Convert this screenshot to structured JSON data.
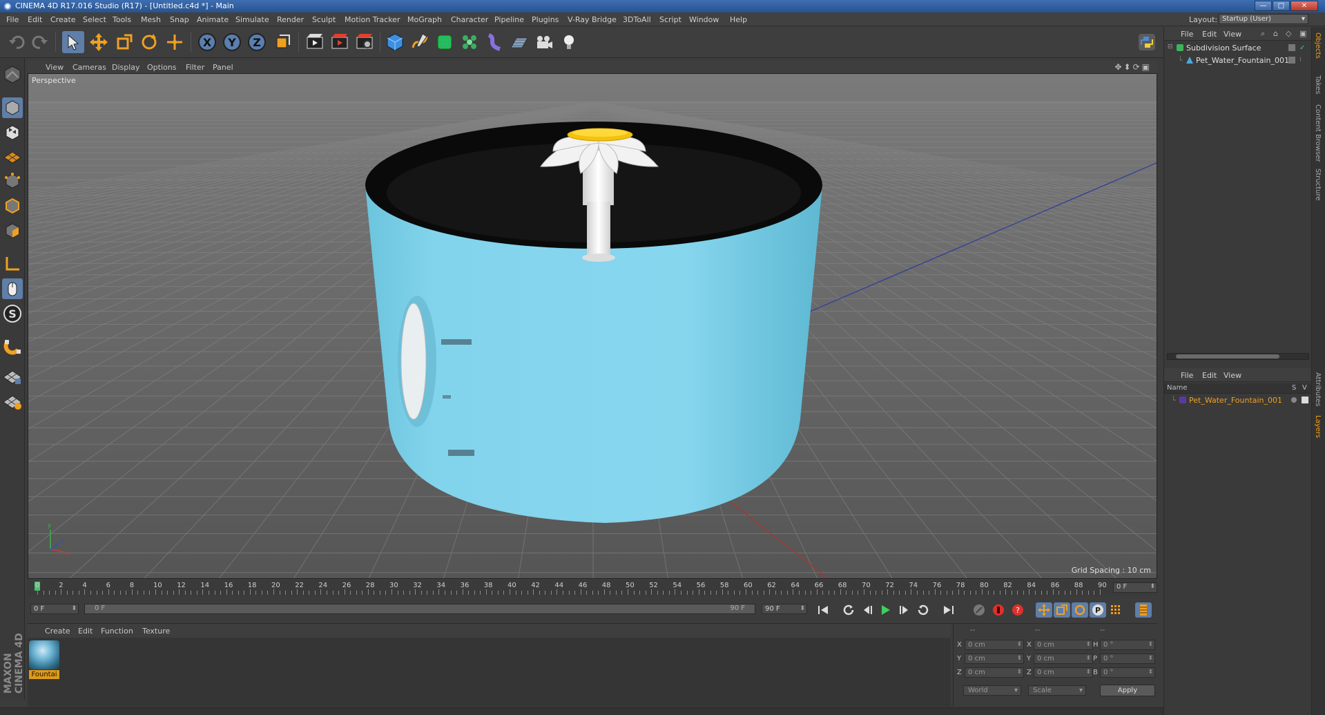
{
  "window": {
    "title": "CINEMA 4D R17.016 Studio (R17) - [Untitled.c4d *] - Main",
    "minimize": "—",
    "maximize": "□",
    "close": "✕"
  },
  "menubar": {
    "items": [
      "File",
      "Edit",
      "Create",
      "Select",
      "Tools",
      "Mesh",
      "Snap",
      "Animate",
      "Simulate",
      "Render",
      "Sculpt",
      "Motion Tracker",
      "MoGraph",
      "Character",
      "Pipeline",
      "Plugins",
      "V-Ray Bridge",
      "3DToAll",
      "Script",
      "Window",
      "Help"
    ],
    "layout_label": "Layout:",
    "layout_value": "Startup (User)"
  },
  "toolbar": {
    "icons": [
      "undo-icon",
      "redo-icon",
      "live-selection-icon",
      "move-icon",
      "scale-icon",
      "rotate-icon",
      "recent-tool-icon",
      "x-axis-icon",
      "y-axis-icon",
      "z-axis-icon",
      "coordinate-system-icon",
      "render-view-icon",
      "render-picture-viewer-icon",
      "edit-render-settings-icon",
      "cube-icon",
      "pen-spline-icon",
      "subdivision-surface-icon",
      "cloner-icon",
      "deformer-icon",
      "floor-icon",
      "camera-icon",
      "light-icon",
      "python-icon"
    ],
    "axis_x": "X",
    "axis_y": "Y",
    "axis_z": "Z"
  },
  "left_toolbar": {
    "icons": [
      "make-editable-icon",
      "model-mode-icon",
      "texture-mode-icon",
      "workplane-icon",
      "points-mode-icon",
      "edges-mode-icon",
      "polygons-mode-icon",
      "axis-mode-icon",
      "tweak-mode-icon",
      "solo-icon",
      "snap-icon",
      "grid-lock-icon",
      "quantize-icon"
    ],
    "solo_letter": "S",
    "brand": "MAXON CINEMA 4D"
  },
  "viewport": {
    "menu": [
      "View",
      "Cameras",
      "Display",
      "Options",
      "Filter",
      "Panel"
    ],
    "label": "Perspective",
    "grid_spacing": "Grid Spacing : 10 cm",
    "axis_x": "x",
    "axis_y": "y",
    "axis_z": "z",
    "colors": {
      "background": "#6b6b6b",
      "grid": "#7d7d7d",
      "fountain_body": "#7fd2ea",
      "fountain_top": "#0a0a0a",
      "petal": "#f0f0f0",
      "cap": "#f4c20d"
    }
  },
  "timeline": {
    "ticks": [
      "0",
      "2",
      "4",
      "6",
      "8",
      "10",
      "12",
      "14",
      "16",
      "18",
      "20",
      "22",
      "24",
      "26",
      "28",
      "30",
      "32",
      "34",
      "36",
      "38",
      "40",
      "42",
      "44",
      "46",
      "48",
      "50",
      "52",
      "54",
      "56",
      "58",
      "60",
      "62",
      "64",
      "66",
      "68",
      "70",
      "72",
      "74",
      "76",
      "78",
      "80",
      "82",
      "84",
      "86",
      "88",
      "90"
    ],
    "current_frame": "0 F"
  },
  "transport": {
    "start_field": "0 F",
    "slider_left": "0 F",
    "slider_right": "90 F",
    "end_field": "90 F",
    "buttons": [
      "go-to-start-icon",
      "previous-keyframe-icon",
      "previous-frame-icon",
      "play-icon",
      "next-frame-icon",
      "next-keyframe-icon",
      "go-to-end-icon",
      "autokey-icon",
      "record-icon",
      "keyframe-selection-icon",
      "move-key-icon",
      "scale-key-icon",
      "rotate-key-icon",
      "parameter-key-icon",
      "pla-key-icon",
      "timeline-icon"
    ]
  },
  "material_manager": {
    "menu": [
      "Create",
      "Edit",
      "Function",
      "Texture"
    ],
    "materials": [
      {
        "name": "Fountai"
      }
    ]
  },
  "coordinates": {
    "headers": [
      "--",
      "--",
      "--"
    ],
    "rows": [
      {
        "a": "X",
        "av": "0 cm",
        "b": "X",
        "bv": "0 cm",
        "c": "H",
        "cv": "0 °"
      },
      {
        "a": "Y",
        "av": "0 cm",
        "b": "Y",
        "bv": "0 cm",
        "c": "P",
        "cv": "0 °"
      },
      {
        "a": "Z",
        "av": "0 cm",
        "b": "Z",
        "bv": "0 cm",
        "c": "B",
        "cv": "0 °"
      }
    ],
    "space": "World",
    "mode": "Scale",
    "apply": "Apply"
  },
  "object_manager": {
    "menu": [
      "File",
      "Edit",
      "View"
    ],
    "objects": [
      {
        "name": "Subdivision Surface"
      },
      {
        "name": "Pet_Water_Fountain_001"
      }
    ]
  },
  "layer_manager": {
    "menu": [
      "File",
      "Edit",
      "View"
    ],
    "col_name": "Name",
    "col_s": "S",
    "col_v": "V",
    "layers": [
      {
        "name": "Pet_Water_Fountain_001"
      }
    ]
  },
  "side_tabs": [
    "Objects",
    "Takes",
    "Content Browser",
    "Structure",
    "Attributes",
    "Layers"
  ]
}
